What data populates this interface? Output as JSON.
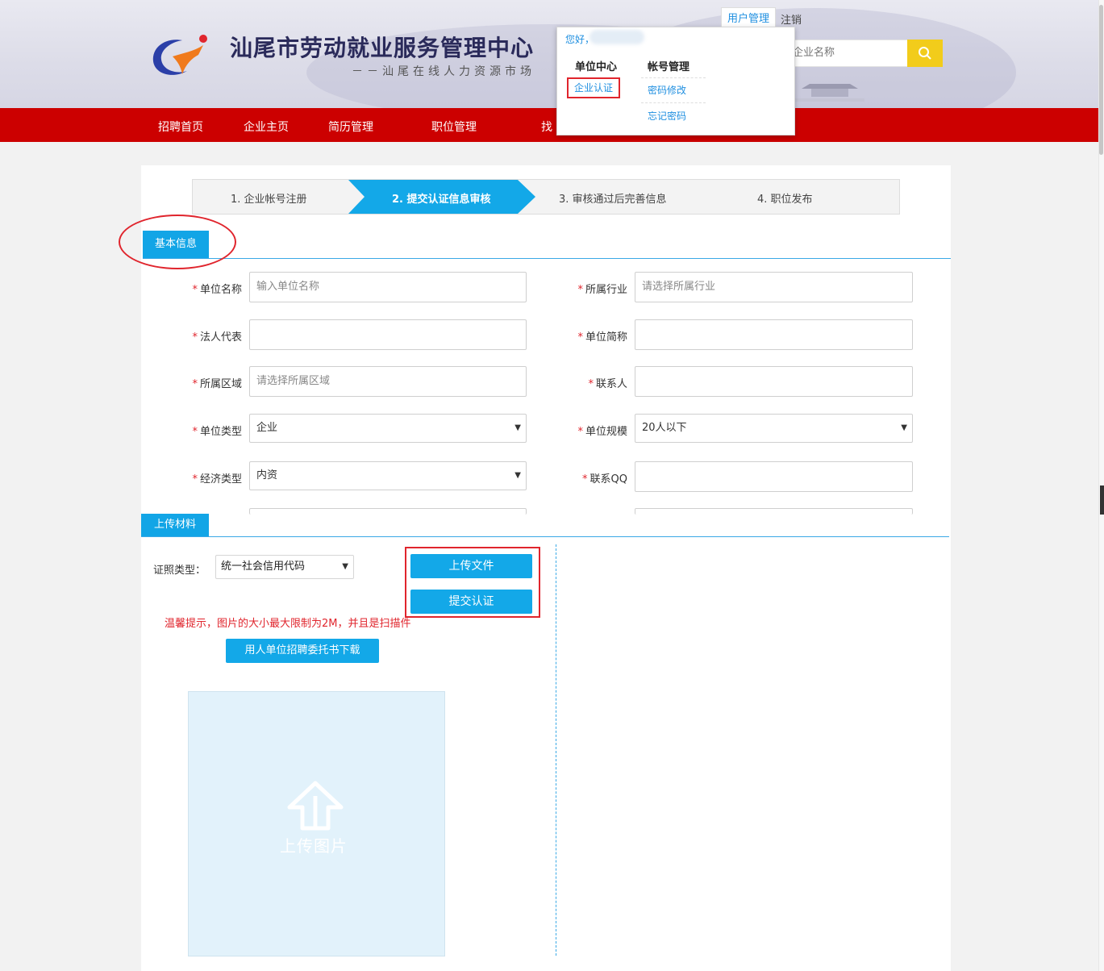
{
  "header": {
    "site_title": "汕尾市劳动就业服务管理中心",
    "site_subtitle": "－－汕尾在线人力资源市场",
    "search_placeholder": "企业名称",
    "top_links": {
      "user_manage": "用户管理",
      "logout": "注销"
    }
  },
  "dropdown": {
    "greeting": "您好，",
    "col1_header": "单位中心",
    "col1_items": [
      "企业认证"
    ],
    "col2_header": "帐号管理",
    "col2_items": [
      "密码修改",
      "忘记密码"
    ]
  },
  "nav": {
    "items": [
      "招聘首页",
      "企业主页",
      "简历管理",
      "职位管理",
      "找"
    ]
  },
  "steps": [
    {
      "label": "1. 企业帐号注册",
      "active": false
    },
    {
      "label": "2. 提交认证信息审核",
      "active": true
    },
    {
      "label": "3. 审核通过后完善信息",
      "active": false
    },
    {
      "label": "4. 职位发布",
      "active": false
    }
  ],
  "basic_info": {
    "section_title": "基本信息",
    "required_mark": "*",
    "fields": {
      "unit_name": {
        "label": "单位名称",
        "placeholder": "输入单位名称"
      },
      "industry": {
        "label": "所属行业",
        "placeholder": "请选择所属行业"
      },
      "legal_rep": {
        "label": "法人代表",
        "value": ""
      },
      "short_name": {
        "label": "单位简称",
        "value": ""
      },
      "region": {
        "label": "所属区域",
        "placeholder": "请选择所属区域"
      },
      "contact": {
        "label": "联系人",
        "value": ""
      },
      "unit_type": {
        "label": "单位类型",
        "value": "企业"
      },
      "unit_scale": {
        "label": "单位规模",
        "value": "20人以下"
      },
      "econ_type": {
        "label": "经济类型",
        "value": "内资"
      },
      "qq": {
        "label": "联系QQ",
        "value": ""
      }
    }
  },
  "upload": {
    "section_title": "上传材料",
    "license_label": "证照类型：",
    "license_value": "统一社会信用代码",
    "upload_file_btn": "上传文件",
    "submit_btn": "提交认证",
    "tip": "温馨提示，图片的大小最大限制为2M，并且是扫描件",
    "download_btn": "用人单位招聘委托书下载",
    "upload_image_label": "上传图片"
  },
  "colors": {
    "nav_red": "#cc0000",
    "accent_blue": "#13a8e8",
    "highlight_red": "#e0252d",
    "search_yellow": "#f2cc1b"
  }
}
